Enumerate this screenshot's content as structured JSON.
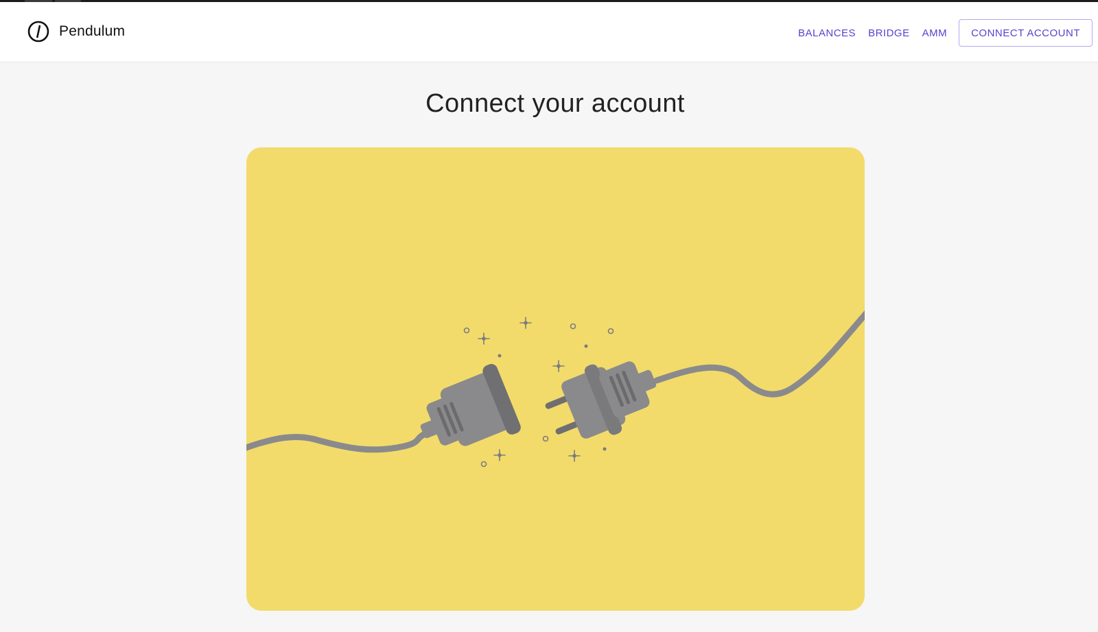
{
  "app": {
    "name": "Pendulum",
    "logo_icon": "pendulum-logo-icon"
  },
  "nav": {
    "links": [
      {
        "label": "BALANCES"
      },
      {
        "label": "BRIDGE"
      },
      {
        "label": "AMM"
      }
    ],
    "connect_label": "CONNECT ACCOUNT"
  },
  "main": {
    "title": "Connect your account",
    "illustration": {
      "icon": "unplugged-cable-illustration",
      "background_color": "#f2db6b",
      "cable_color": "#8a8a8c"
    }
  },
  "colors": {
    "accent": "#5b3fd0",
    "page_background": "#f6f6f6",
    "header_background": "#ffffff"
  }
}
